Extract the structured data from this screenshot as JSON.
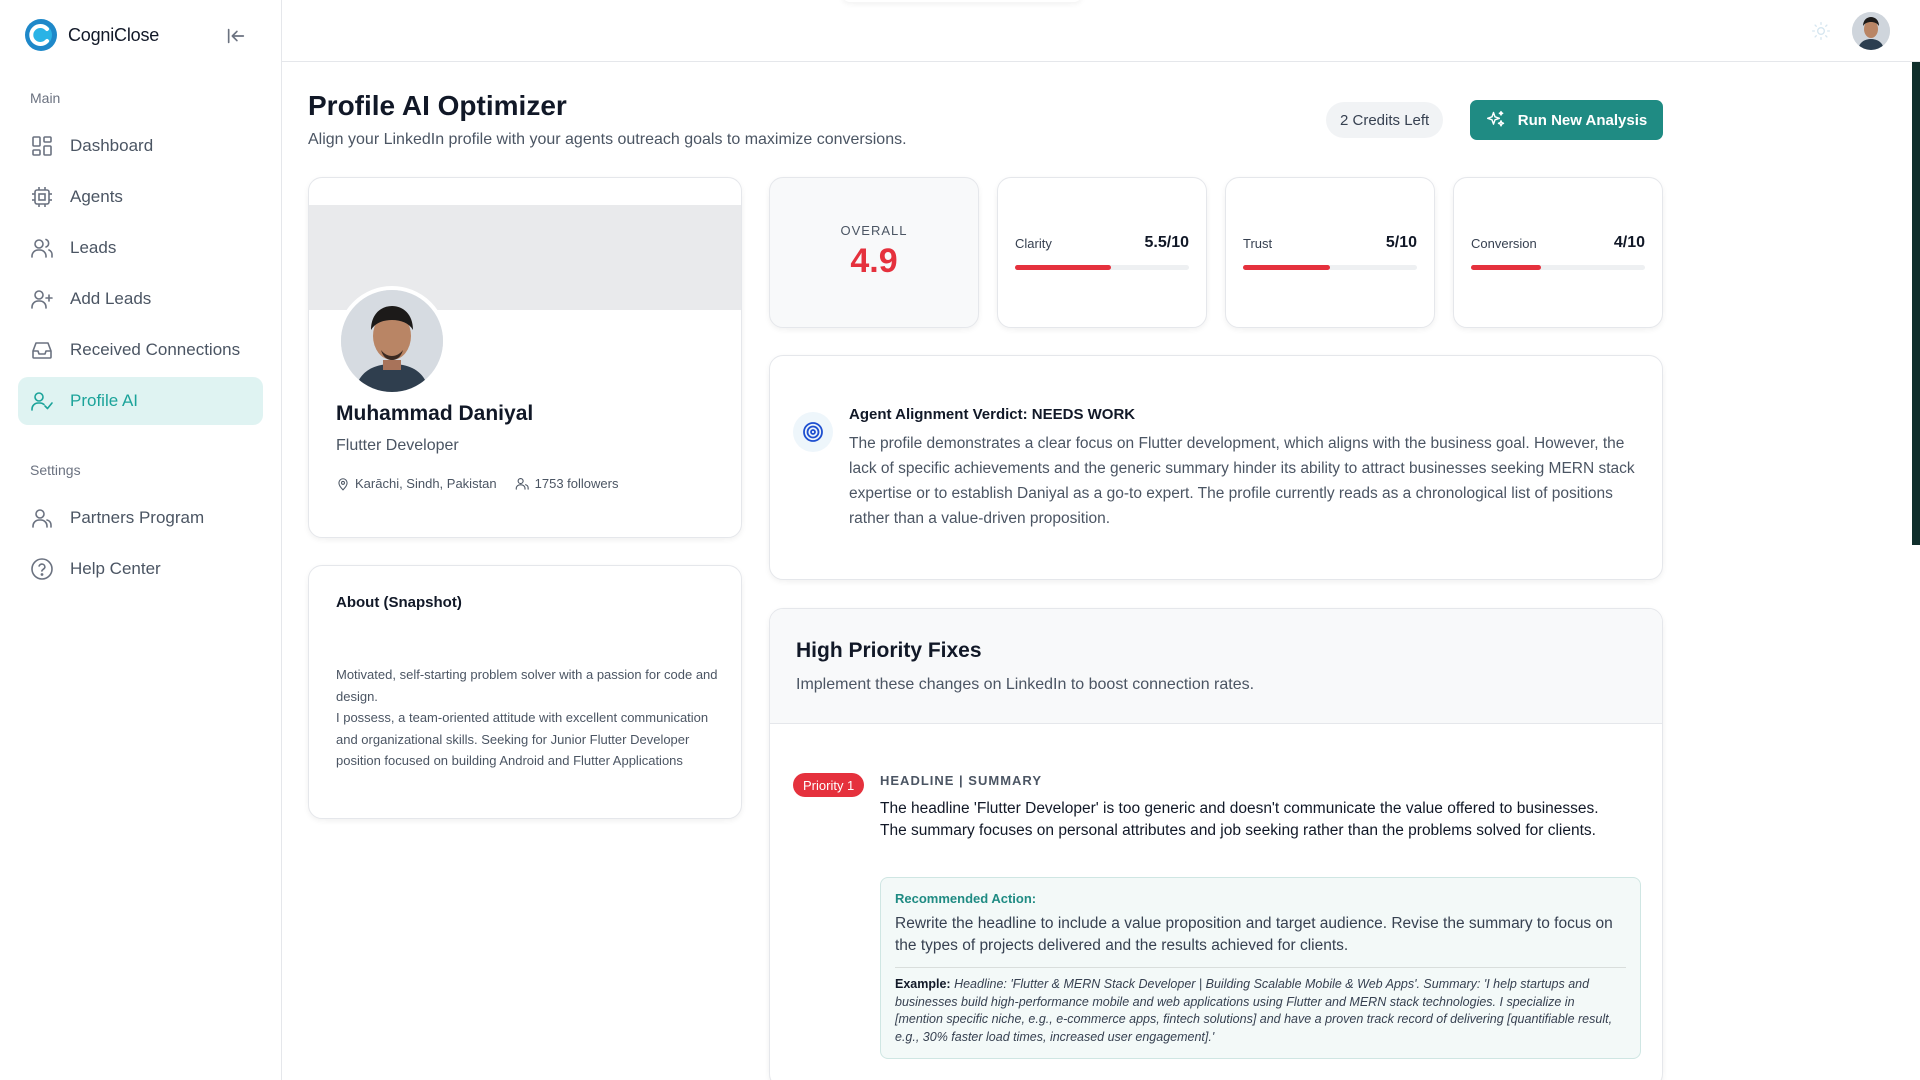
{
  "brand": {
    "name": "CogniClose"
  },
  "sidebar": {
    "main_label": "Main",
    "settings_label": "Settings",
    "items": [
      {
        "label": "Dashboard",
        "icon": "dashboard-icon"
      },
      {
        "label": "Agents",
        "icon": "chip-icon"
      },
      {
        "label": "Leads",
        "icon": "users-icon"
      },
      {
        "label": "Add Leads",
        "icon": "user-plus-icon"
      },
      {
        "label": "Received Connections",
        "icon": "inbox-icon"
      },
      {
        "label": "Profile AI",
        "icon": "user-check-icon",
        "active": true
      }
    ],
    "settings_items": [
      {
        "label": "Partners Program",
        "icon": "users-icon"
      },
      {
        "label": "Help Center",
        "icon": "help-circle-icon"
      }
    ]
  },
  "header": {
    "title": "Profile AI Optimizer",
    "subtitle": "Align your LinkedIn profile with your agents outreach goals to maximize conversions.",
    "credits": "2 Credits Left",
    "run_button": "Run New Analysis"
  },
  "profile": {
    "name": "Muhammad Daniyal",
    "title": "Flutter Developer",
    "location": "Karāchi, Sindh, Pakistan",
    "followers": "1753 followers"
  },
  "about": {
    "title": "About (Snapshot)",
    "text": "Motivated, self-starting problem solver with a passion for code and design.\nI possess, a team-oriented attitude with excellent communication and organizational skills. Seeking for Junior Flutter Developer position focused on building Android and Flutter Applications"
  },
  "scores": {
    "overall_label": "OVERALL",
    "overall_value": "4.9",
    "metrics": [
      {
        "label": "Clarity",
        "value": "5.5/10",
        "fraction": 0.55
      },
      {
        "label": "Trust",
        "value": "5/10",
        "fraction": 0.5
      },
      {
        "label": "Conversion",
        "value": "4/10",
        "fraction": 0.4
      }
    ],
    "accent_color": "#e5313d"
  },
  "verdict": {
    "title": "Agent Alignment Verdict: NEEDS WORK",
    "text": "The profile demonstrates a clear focus on Flutter development, which aligns with the business goal. However, the lack of specific achievements and the generic summary hinder its ability to attract businesses seeking MERN stack expertise or to establish Daniyal as a go-to expert. The profile currently reads as a chronological list of positions rather than a value-driven proposition."
  },
  "fixes": {
    "title": "High Priority Fixes",
    "subtitle": "Implement these changes on LinkedIn to boost connection rates.",
    "items": [
      {
        "badge": "Priority 1",
        "tags": "HEADLINE | SUMMARY",
        "description": "The headline 'Flutter Developer' is too generic and doesn't communicate the value offered to businesses. The summary focuses on personal attributes and job seeking rather than the problems solved for clients.",
        "rec_label": "Recommended Action:",
        "rec_text": "Rewrite the headline to include a value proposition and target audience. Revise the summary to focus on the types of projects delivered and the results achieved for clients.",
        "example_label": "Example:",
        "example_text": "Headline: 'Flutter & MERN Stack Developer | Building Scalable Mobile & Web Apps'. Summary: 'I help startups and businesses build high-performance mobile and web applications using Flutter and MERN stack technologies. I specialize in [mention specific niche, e.g., e-commerce apps, fintech solutions] and have a proven track record of delivering [quantifiable result, e.g., 30% faster load times, increased user engagement].'"
      }
    ]
  },
  "colors": {
    "brand": "#1f8b83",
    "active_bg": "#dff3f2",
    "active_text": "#1ba39a"
  }
}
